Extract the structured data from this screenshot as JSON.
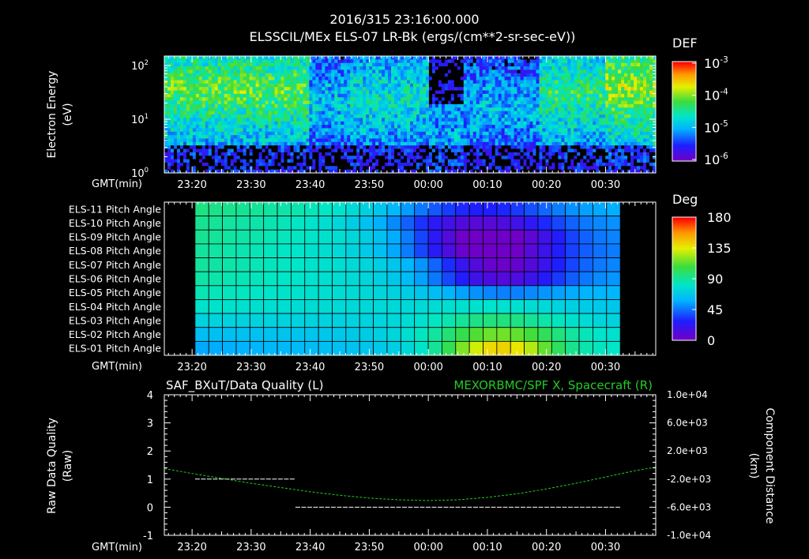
{
  "header": {
    "timestamp": "2016/315 23:16:00.000",
    "title": "ELSSCIL/MEx ELS-07 LR-Bk  (ergs/(cm**2-sr-sec-eV))"
  },
  "chart_data": [
    {
      "type": "heatmap",
      "name": "spectrogram",
      "ylabel_line1": "Electron Energy",
      "ylabel_line2": "(eV)",
      "xlabel": "GMT(min)",
      "yscale": "log",
      "ylim": [
        1,
        150
      ],
      "y_ticks": [
        {
          "base": "10",
          "exp": "0",
          "value": 1
        },
        {
          "base": "10",
          "exp": "1",
          "value": 10
        },
        {
          "base": "10",
          "exp": "2",
          "value": 100
        }
      ],
      "x_ticks": [
        "23:20",
        "23:30",
        "23:40",
        "23:50",
        "00:00",
        "00:10",
        "00:20",
        "00:30"
      ],
      "x_tick_minutes": [
        20,
        30,
        40,
        50,
        60,
        70,
        80,
        90
      ],
      "xlim_minutes": [
        15.3,
        98.5
      ],
      "colorbar": {
        "label": "DEF",
        "scale": "log",
        "ticks": [
          {
            "base": "10",
            "exp": "-3"
          },
          {
            "base": "10",
            "exp": "-4"
          },
          {
            "base": "10",
            "exp": "-5"
          },
          {
            "base": "10",
            "exp": "-6"
          }
        ]
      }
    },
    {
      "type": "heatmap",
      "name": "pitch-angle",
      "xlabel": "GMT(min)",
      "x_ticks": [
        "23:20",
        "23:30",
        "23:40",
        "23:50",
        "00:00",
        "00:10",
        "00:20",
        "00:30"
      ],
      "x_tick_minutes": [
        20,
        30,
        40,
        50,
        60,
        70,
        80,
        90
      ],
      "xlim_minutes": [
        15.3,
        98.5
      ],
      "data_range_minutes": [
        20.5,
        92.5
      ],
      "rows": [
        "ELS-11 Pitch Angle",
        "ELS-10 Pitch Angle",
        "ELS-09 Pitch Angle",
        "ELS-08 Pitch Angle",
        "ELS-07 Pitch Angle",
        "ELS-06 Pitch Angle",
        "ELS-05 Pitch Angle",
        "ELS-04 Pitch Angle",
        "ELS-03 Pitch Angle",
        "ELS-02 Pitch Angle",
        "ELS-01 Pitch Angle"
      ],
      "colorbar": {
        "label": "Deg",
        "ticks": [
          "180",
          "135",
          "90",
          "45",
          "0"
        ],
        "range": [
          0,
          180
        ]
      },
      "row_profiles_deg": [
        {
          "start": 95,
          "end": 60,
          "dip": 45,
          "dip_center_min": 68,
          "dip_width_min": 15
        },
        {
          "start": 92,
          "end": 55,
          "dip": 60,
          "dip_center_min": 68,
          "dip_width_min": 15
        },
        {
          "start": 92,
          "end": 52,
          "dip": 75,
          "dip_center_min": 70,
          "dip_width_min": 13
        },
        {
          "start": 90,
          "end": 50,
          "dip": 70,
          "dip_center_min": 70,
          "dip_width_min": 13
        },
        {
          "start": 90,
          "end": 52,
          "dip": 62,
          "dip_center_min": 72,
          "dip_width_min": 12
        },
        {
          "start": 88,
          "end": 55,
          "dip": 55,
          "dip_center_min": 72,
          "dip_width_min": 12
        },
        {
          "start": 85,
          "end": 60,
          "dip": 20,
          "dip_center_min": 72,
          "dip_width_min": 12
        },
        {
          "start": 80,
          "end": 65,
          "dip": -10,
          "dip_center_min": 72,
          "dip_width_min": 12
        },
        {
          "start": 72,
          "end": 70,
          "dip": -25,
          "dip_center_min": 72,
          "dip_width_min": 12
        },
        {
          "start": 62,
          "end": 75,
          "dip": -45,
          "dip_center_min": 72,
          "dip_width_min": 12
        },
        {
          "start": 55,
          "end": 80,
          "dip": -70,
          "dip_center_min": 72,
          "dip_width_min": 10
        }
      ]
    },
    {
      "type": "line",
      "name": "line-plot",
      "title_left": "SAF_BXuT/Data Quality (L)",
      "title_right": "MEXORBMC/SPF X, Spacecraft (R)",
      "ylabel_left_line1": "Raw Data Quality",
      "ylabel_left_line2": "(Raw)",
      "ylabel_right_line1": "Component Distance",
      "ylabel_right_line2": "(km)",
      "xlabel": "GMT(min)",
      "x_ticks": [
        "23:20",
        "23:30",
        "23:40",
        "23:50",
        "00:00",
        "00:10",
        "00:20",
        "00:30"
      ],
      "x_tick_minutes": [
        20,
        30,
        40,
        50,
        60,
        70,
        80,
        90
      ],
      "xlim_minutes": [
        15.3,
        98.5
      ],
      "ylim_left": [
        -1,
        4
      ],
      "y_ticks_left": [
        "4",
        "3",
        "2",
        "1",
        "0",
        "-1"
      ],
      "ylim_right": [
        -10000,
        10000
      ],
      "y_ticks_right": [
        "1.0e+04",
        "6.0e+03",
        "2.0e+03",
        "-2.0e+03",
        "-6.0e+03",
        "-1.0e+04"
      ],
      "series": [
        {
          "name": "SAF_BXuT/Data Quality (L)",
          "color": "#ffffff",
          "axis": "left",
          "segments": [
            {
              "x": [
                20.5,
                37.5
              ],
              "y": [
                1,
                1
              ]
            },
            {
              "x": [
                37.5,
                92.5
              ],
              "y": [
                0,
                0
              ]
            }
          ]
        },
        {
          "name": "MEXORBMC/SPF X, Spacecraft (R)",
          "color": "#22cc22",
          "axis": "right",
          "x": [
            15.3,
            20,
            25,
            30,
            35,
            40,
            45,
            50,
            55,
            60,
            65,
            70,
            75,
            80,
            85,
            90,
            95,
            98.5
          ],
          "y": [
            -500,
            -1200,
            -1900,
            -2600,
            -3200,
            -3800,
            -4300,
            -4700,
            -4950,
            -5050,
            -4950,
            -4600,
            -4100,
            -3400,
            -2600,
            -1700,
            -800,
            -300
          ]
        }
      ]
    }
  ]
}
